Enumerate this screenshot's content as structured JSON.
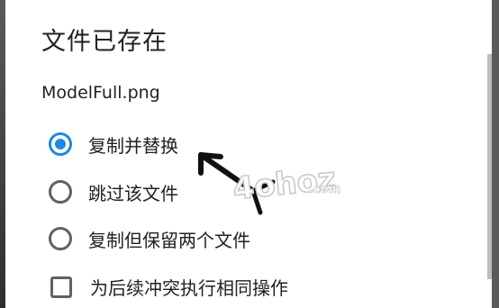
{
  "dialog": {
    "title": "文件已存在",
    "filename": "ModelFull.png",
    "options": [
      {
        "label": "复制并替换",
        "selected": true
      },
      {
        "label": "跳过该文件",
        "selected": false
      },
      {
        "label": "复制但保留两个文件",
        "selected": false
      }
    ],
    "apply_all": {
      "label": "为后续冲突执行相同操作",
      "checked": false
    }
  },
  "watermark": {
    "logo_text": "4ohoz",
    "domain": ".com"
  },
  "colors": {
    "accent": "#1e88e5",
    "text": "#212121",
    "control": "#616161"
  }
}
